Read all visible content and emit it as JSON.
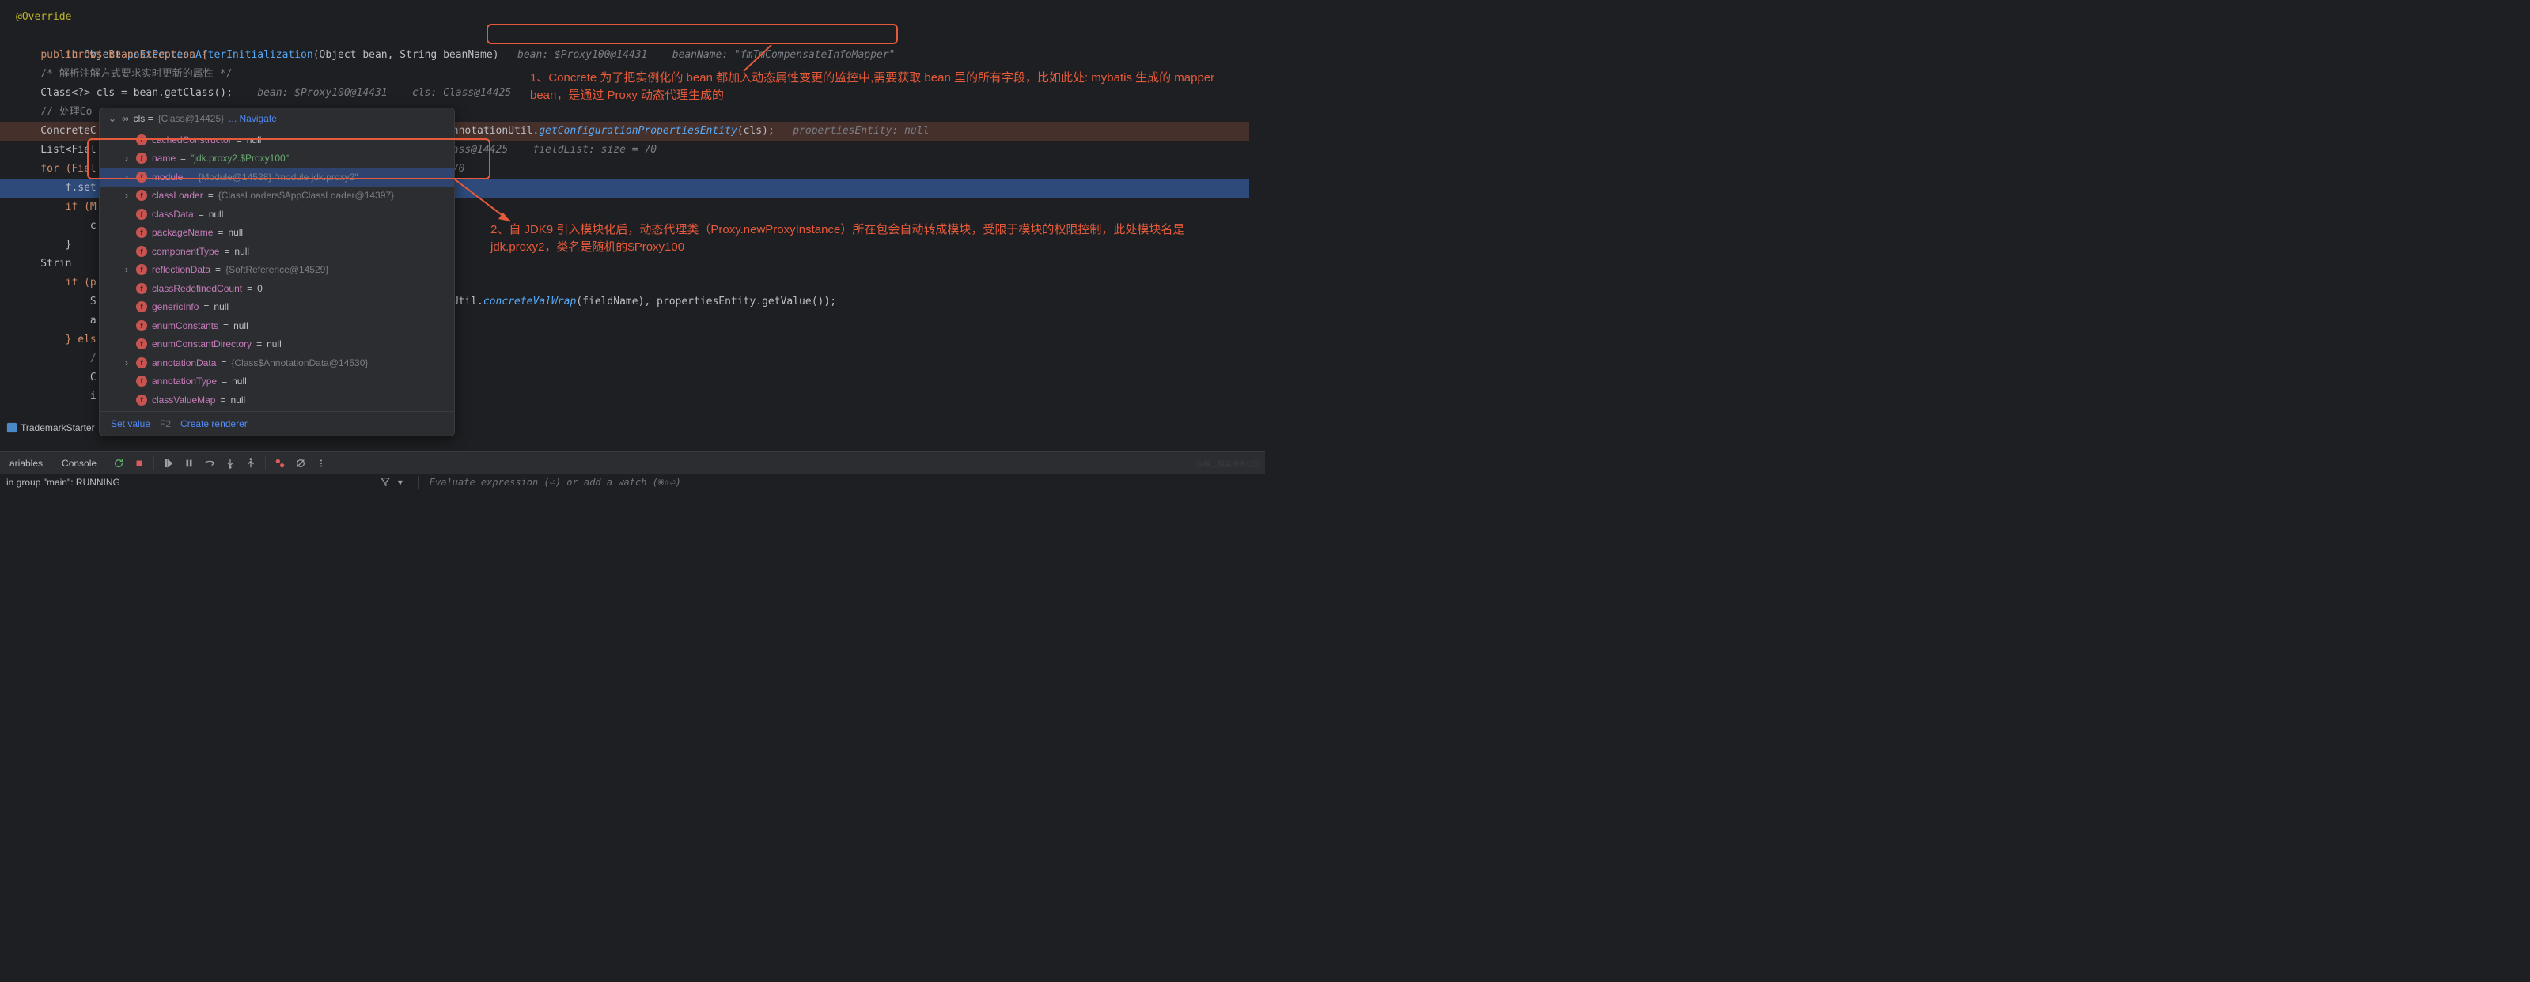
{
  "code": {
    "l1_anno": "@Override",
    "l2_kw1": "public",
    "l2_type1": "Object",
    "l2_method": "postProcessAfterInitialization",
    "l2_params": "(Object bean, String beanName)",
    "l2_hint1_label": "bean:",
    "l2_hint1_val": "$Proxy100@14431",
    "l2_hint2_label": "beanName:",
    "l2_hint2_val": "\"fmTmCompensateInfoMapper\"",
    "l3": "        throws BeansException {",
    "l4_comment": "    /* 解析注解方式要求实时更新的属性 */",
    "l5_a": "    Class<?> ",
    "l5_var": "cls",
    "l5_b": " = bean.getClass();",
    "l5_hint1_label": "bean:",
    "l5_hint1_val": "$Proxy100@14431",
    "l5_hint2_label": "cls:",
    "l5_hint2_val": "Class@14425",
    "l6_comment": "    // 处理Co",
    "l7_a": "    ConcreteC",
    "l7_method": "getConfigurationPropertiesEntity",
    "l7_b": "(cls);",
    "l7_hint_label": "propertiesEntity:",
    "l7_hint_val": "null",
    "l7_prefix": "nnotationUtil.",
    "l8_a": "    List<Fiel",
    "l8_hint1": "ass@14425",
    "l8_hint2_label": "fieldList:",
    "l8_hint2_val": " size = 70",
    "l9_a": "    for (Fiel",
    "l9_hint": "70",
    "l10": "        f.set",
    "l11": "        if (M",
    "l12": "            c",
    "l13": "        }",
    "l14": "    Strin",
    "l15": "        if (p",
    "l16": "            S",
    "l16_suffix_a": "Util.",
    "l16_method": "concreteValWrap",
    "l16_suffix_b": "(fieldName), propertiesEntity.getValue());",
    "l17": "            a",
    "l18": "        } els",
    "l19": "            /",
    "l20": "            C",
    "l21": "            i"
  },
  "popup": {
    "header_var": "cls",
    "header_val": "{Class@14425}",
    "navigate": "... Navigate",
    "fields": [
      {
        "exp": false,
        "name": "cachedConstructor",
        "val": "null",
        "t": "null"
      },
      {
        "exp": true,
        "name": "name",
        "val": "\"jdk.proxy2.$Proxy100\"",
        "t": "str"
      },
      {
        "exp": true,
        "name": "module",
        "val": "{Module@14528} \"module jdk.proxy2\"",
        "t": "obj",
        "sel": true
      },
      {
        "exp": true,
        "name": "classLoader",
        "val": "{ClassLoaders$AppClassLoader@14397}",
        "t": "obj"
      },
      {
        "exp": false,
        "name": "classData",
        "val": "null",
        "t": "null"
      },
      {
        "exp": false,
        "name": "packageName",
        "val": "null",
        "t": "null"
      },
      {
        "exp": false,
        "name": "componentType",
        "val": "null",
        "t": "null"
      },
      {
        "exp": true,
        "name": "reflectionData",
        "val": "{SoftReference@14529}",
        "t": "obj"
      },
      {
        "exp": false,
        "name": "classRedefinedCount",
        "val": "0",
        "t": "null"
      },
      {
        "exp": false,
        "name": "genericInfo",
        "val": "null",
        "t": "null"
      },
      {
        "exp": false,
        "name": "enumConstants",
        "val": "null",
        "t": "null"
      },
      {
        "exp": false,
        "name": "enumConstantDirectory",
        "val": "null",
        "t": "null"
      },
      {
        "exp": true,
        "name": "annotationData",
        "val": "{Class$AnnotationData@14530}",
        "t": "obj"
      },
      {
        "exp": false,
        "name": "annotationType",
        "val": "null",
        "t": "null"
      },
      {
        "exp": false,
        "name": "classValueMap",
        "val": "null",
        "t": "null"
      }
    ],
    "set_value": "Set value",
    "set_value_key": "F2",
    "create_renderer": "Create renderer"
  },
  "callouts": {
    "c1": "1、Concrete 为了把实例化的 bean 都加入动态属性变更的监控中,需要获取 bean 里的所有字段，比如此处: mybatis 生成的 mapper bean，是通过 Proxy 动态代理生成的",
    "c2": "2、自 JDK9 引入模块化后，动态代理类（Proxy.newProxyInstance）所在包会自动转成模块，受限于模块的权限控制，此处模块名是jdk.proxy2，类名是随机的$Proxy100"
  },
  "gutter": {
    "app_label": "TrademarkStarter"
  },
  "tabs": {
    "variables": "ariables",
    "console": "Console"
  },
  "status": {
    "running": "in group \"main\": RUNNING",
    "expr_placeholder": "Evaluate expression (⏎) or add a watch (⌘⇧⏎)"
  },
  "watermark": "@稀土掘金技术社区"
}
